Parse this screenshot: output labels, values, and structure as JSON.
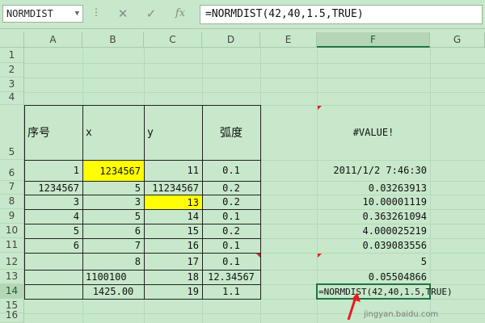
{
  "toolbar": {
    "name_box": "NORMDIST",
    "formula": "=NORMDIST(42,40,1.5,TRUE)",
    "fx_label": "fx"
  },
  "columns": [
    "A",
    "B",
    "C",
    "D",
    "E",
    "F",
    "G"
  ],
  "rows": [
    "1",
    "2",
    "3",
    "4",
    "5",
    "6",
    "7",
    "8",
    "9",
    "10",
    "11",
    "12",
    "13",
    "14",
    "15",
    "16"
  ],
  "headers": {
    "a": "序号",
    "b": "x",
    "c": "y",
    "d": "弧度"
  },
  "cells": {
    "F5": "#VALUE!",
    "A6": "1",
    "B6": "1234567",
    "C6": "11",
    "D6": "0.1",
    "F6": "2011/1/2 7:46:30",
    "A7": "1234567",
    "B7": "5",
    "C7": "11234567",
    "D7": "0.2",
    "F7": "0.03263913",
    "A8": "3",
    "B8": "3",
    "C8": "13",
    "D8": "0.2",
    "F8": "10.00001119",
    "A9": "4",
    "B9": "5",
    "C9": "14",
    "D9": "0.1",
    "F9": "0.363261094",
    "A10": "5",
    "B10": "6",
    "C10": "15",
    "D10": "0.2",
    "F10": "4.000025219",
    "A11": "6",
    "B11": "7",
    "C11": "16",
    "D11": "0.1",
    "F11": "0.039083556",
    "B12": "8",
    "C12": "17",
    "D12": "0.1",
    "F12": "5",
    "B13": "1100100",
    "C13": "18",
    "D13": "12.34567",
    "F13": "0.05504866",
    "B14": "1425.00",
    "C14": "19",
    "D14": "1.1",
    "F14": "=NORMDIST(42,40,1.5,TRUE)"
  },
  "watermark": "jingyan.baidu.com",
  "colors": {
    "sheet_bg": "#c7e8ca",
    "highlight": "#ffff00",
    "accent": "#217346",
    "arrow": "#e02020"
  }
}
